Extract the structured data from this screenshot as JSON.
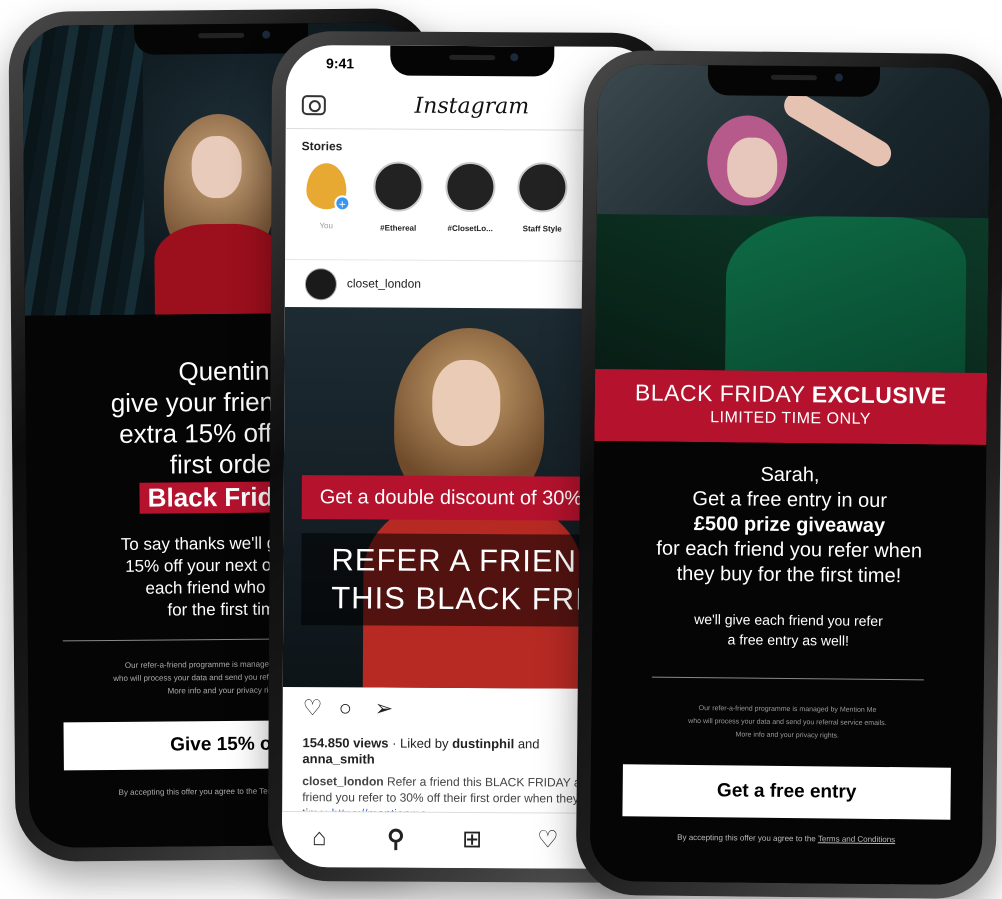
{
  "left_phone": {
    "headline_lines": [
      "Quentin",
      "give your friends an",
      "extra 15% off their",
      "first order"
    ],
    "highlight": "Black Friday",
    "sub_lines": [
      "To say thanks we'll give you",
      "15% off your next order for",
      "each friend who buys",
      "for the first time"
    ],
    "privacy_lines": [
      "Our refer-a-friend programme is managed by Mention Me",
      "who will process your data and send you referral service emails.",
      "More info and your privacy rights."
    ],
    "cta": "Give 15% off",
    "terms": "By accepting this offer you agree to the Terms and Conditions"
  },
  "middle_phone": {
    "time": "9:41",
    "app_name": "Instagram",
    "stories_label": "Stories",
    "stories": [
      {
        "name": "You",
        "dim": true
      },
      {
        "name": "#Ethereal",
        "dim": false
      },
      {
        "name": "#ClosetLo...",
        "dim": false
      },
      {
        "name": "Staff Style",
        "dim": false
      }
    ],
    "post_user": "closet_london",
    "banner": "Get a double discount of 30%",
    "headline_lines": [
      "REFER A FRIEND",
      "THIS BLACK FRIDAY"
    ],
    "views_bold": "154.850 views",
    "liked_prefix": " · Liked by ",
    "liked_user": "dustinphil",
    "liked_and": " and",
    "liked_user2": "anna_smith",
    "caption_user": "closet_london",
    "caption_text": " Refer a friend this BLACK FRIDAY and treat each friend you refer to 30% off their first order when they buy for the first time: ",
    "caption_link": "https://mentionme..."
  },
  "right_phone": {
    "banner_regular": "BLACK FRIDAY ",
    "banner_bold": "EXCLUSIVE",
    "banner_sub": "LIMITED TIME ONLY",
    "greeting": "Sarah,",
    "line1": "Get a free entry in our",
    "prize": "£500 prize giveaway",
    "line3": "for each friend you refer when",
    "line4": "they buy for the first time!",
    "sub1": "we'll give each friend you refer",
    "sub2": "a free entry as well!",
    "privacy_lines": [
      "Our refer-a-friend programme is managed by Mention Me",
      "who will process your data and send you referral service emails.",
      "More info and your privacy rights."
    ],
    "cta": "Get a free entry",
    "terms_prefix": "By accepting this offer you agree to the ",
    "terms_link": "Terms and Conditions"
  },
  "colors": {
    "accent_red": "#b4122d",
    "background_dark": "#050505",
    "instagram_link": "#3b6cc4",
    "story_add_blue": "#3897f0",
    "story_you_yellow": "#e7a931"
  },
  "icons": [
    "camera-icon",
    "heart-icon",
    "comment-icon",
    "send-icon",
    "home-icon",
    "search-icon",
    "add-post-icon",
    "activity-icon"
  ]
}
